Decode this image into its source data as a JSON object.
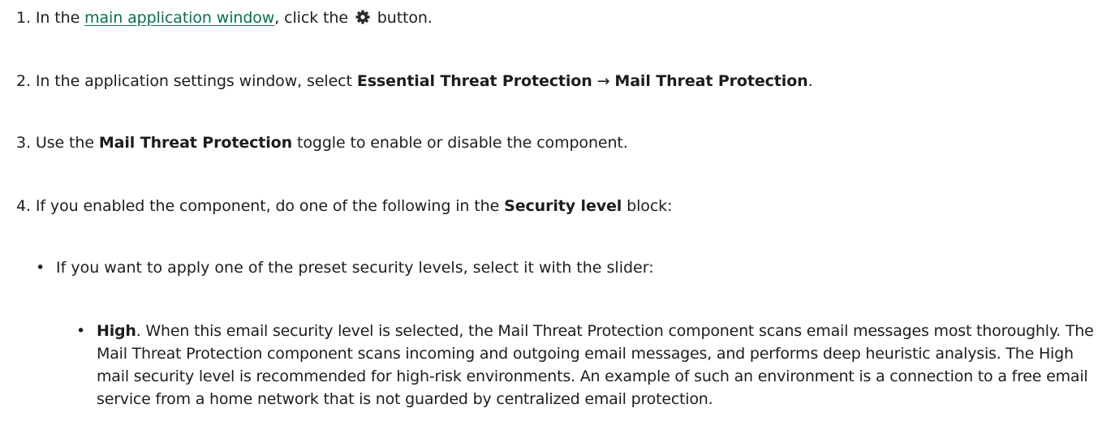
{
  "steps": [
    {
      "number": "1.",
      "text_before_link": "In the ",
      "link_text": "main application window",
      "text_after_link": ", click the ",
      "icon": "gear-icon",
      "text_end": " button."
    },
    {
      "number": "2.",
      "text_before": "In the application settings window, select ",
      "bold_1": "Essential Threat Protection",
      "arrow": " → ",
      "bold_2": "Mail Threat Protection",
      "text_end": "."
    },
    {
      "number": "3.",
      "text_before": "Use the ",
      "bold": "Mail Threat Protection",
      "text_end": " toggle to enable or disable the component."
    },
    {
      "number": "4.",
      "text_before": "If you enabled the component, do one of the following in the ",
      "bold": "Security level",
      "text_end": " block:"
    }
  ],
  "bullet": {
    "symbol": "•",
    "text": "If you want to apply one of the preset security levels, select it with the slider:"
  },
  "sub_bullet": {
    "symbol": "•",
    "bold": "High",
    "text": ". When this email security level is selected, the Mail Threat Protection component scans email messages most thoroughly. The Mail Threat Protection component scans incoming and outgoing email messages, and performs deep heuristic analysis. The High mail security level is recommended for high-risk environments. An example of such an environment is a connection to a free email service from a home network that is not guarded by centralized email protection."
  },
  "colors": {
    "link": "#00734f",
    "text": "#1d1d1b"
  }
}
